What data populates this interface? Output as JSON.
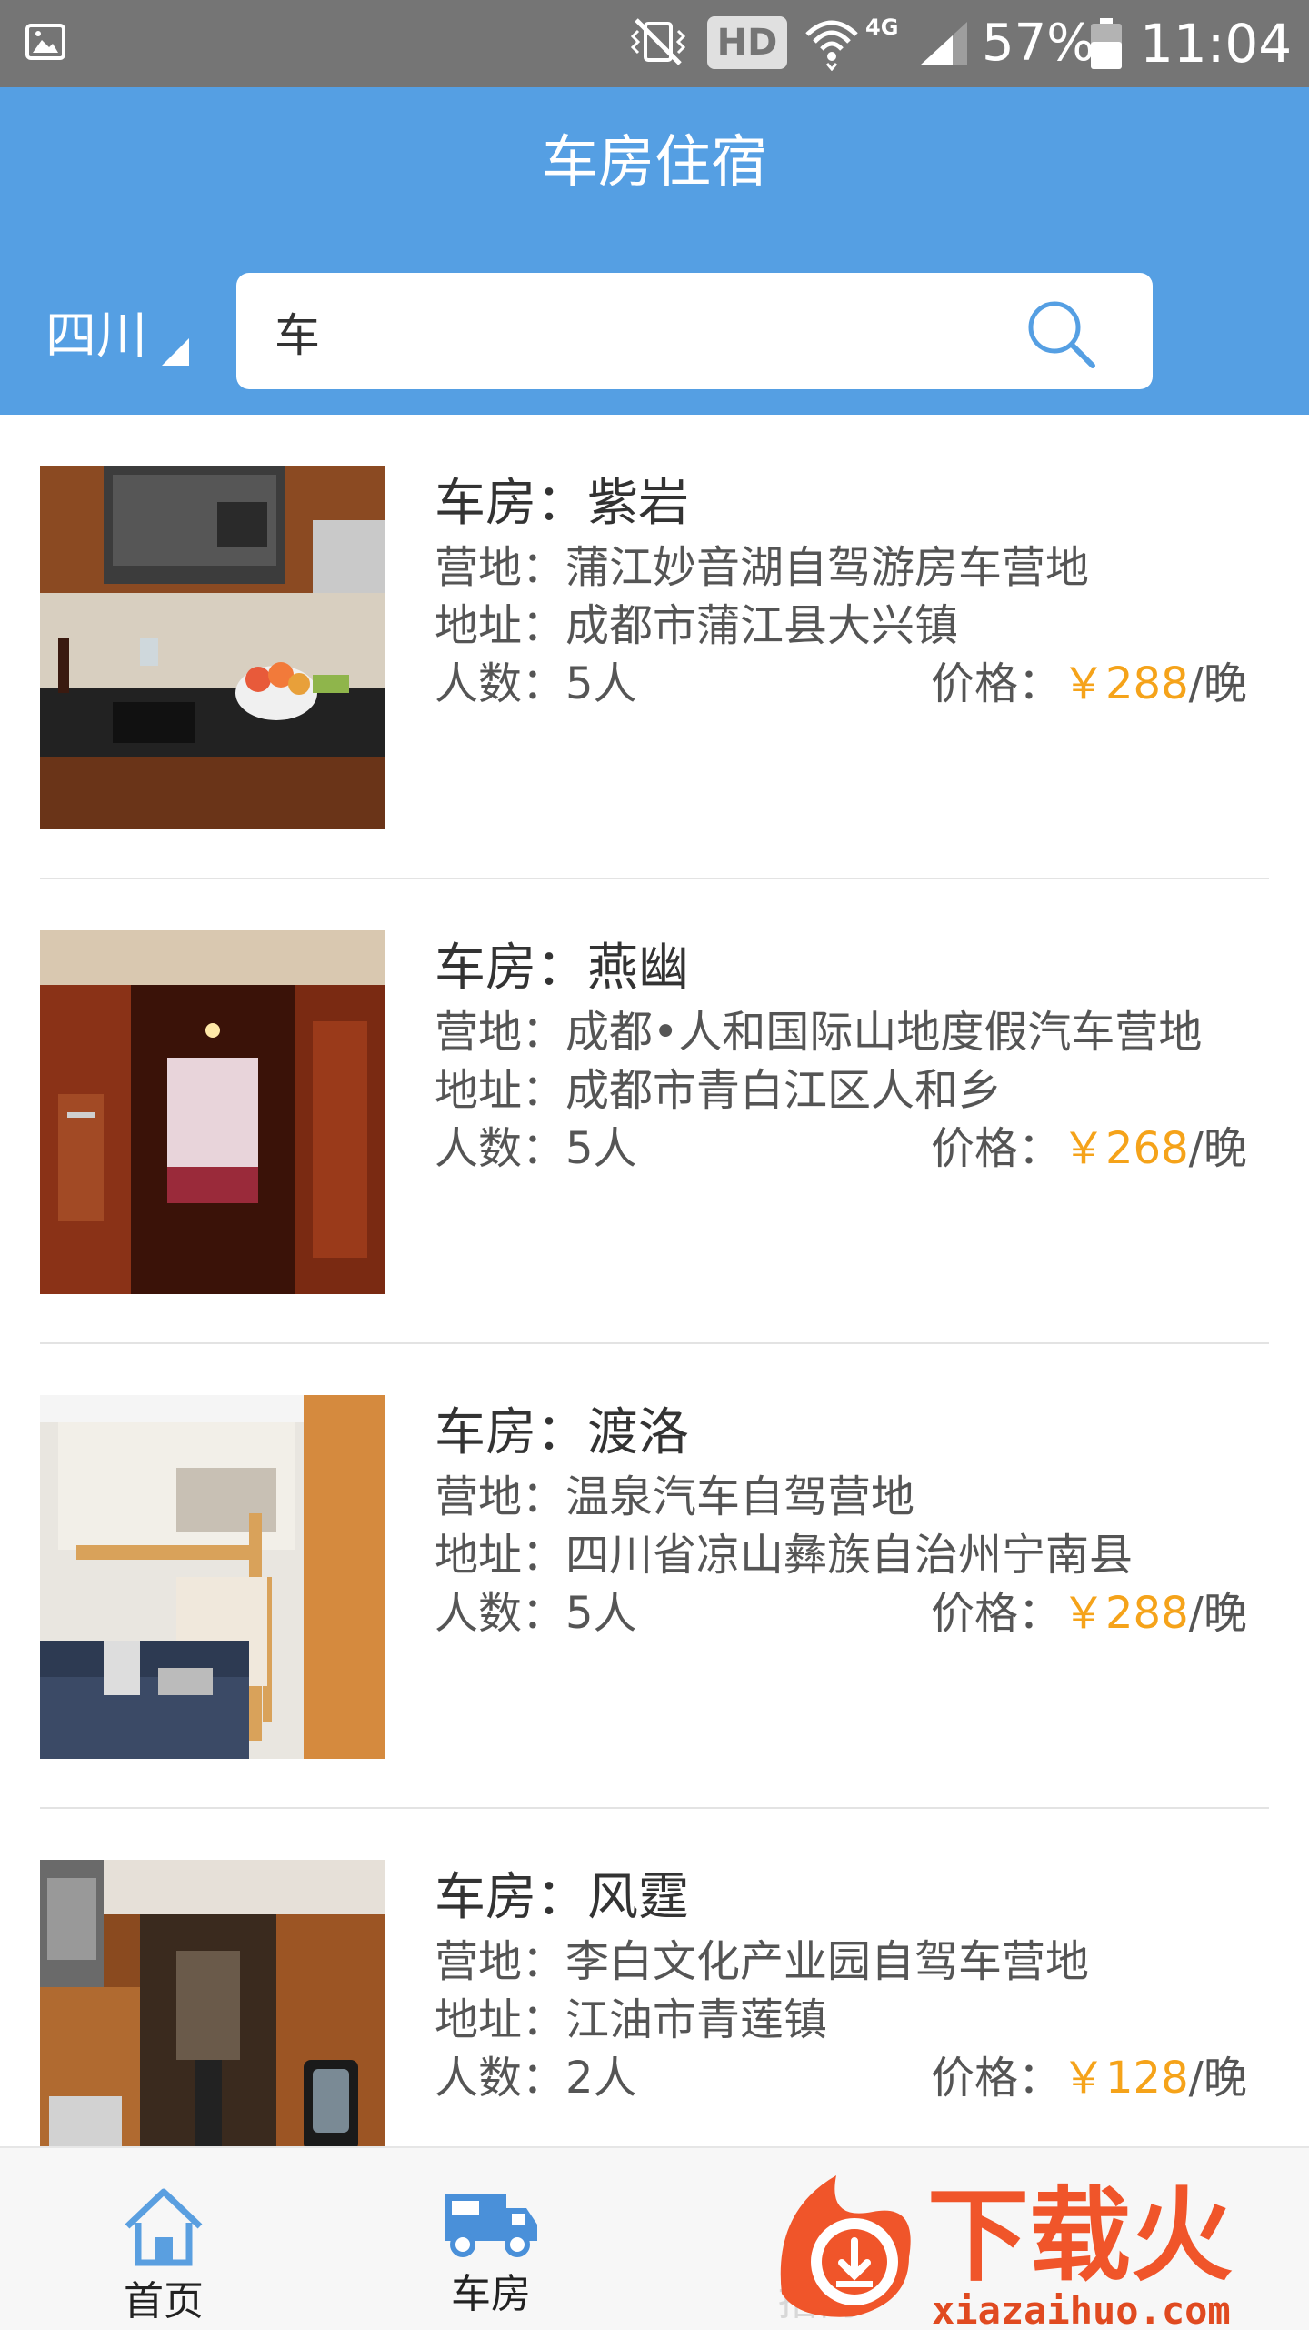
{
  "status_bar": {
    "network": "4G",
    "hd_label": "HD",
    "battery": "57%",
    "time": "11:04"
  },
  "header": {
    "title": "车房住宿",
    "region": "四川",
    "search": {
      "value": "车",
      "placeholder": ""
    },
    "accent": "#559fe3"
  },
  "listings": [
    {
      "name": "车房：紫岩",
      "camp": "营地：蒲江妙音湖自驾游房车营地",
      "address": "地址：成都市蒲江县大兴镇",
      "people": "人数：5人",
      "price_label": "价格：",
      "price": "￥288",
      "unit": "/晚"
    },
    {
      "name": "车房：燕幽",
      "camp": "营地：成都•人和国际山地度假汽车营地",
      "address": "地址：成都市青白江区人和乡",
      "people": "人数：5人",
      "price_label": "价格：",
      "price": "￥268",
      "unit": "/晚"
    },
    {
      "name": "车房：渡洛",
      "camp": "营地：温泉汽车自驾营地",
      "address": "地址：四川省凉山彝族自治州宁南县",
      "people": "人数：5人",
      "price_label": "价格：",
      "price": "￥288",
      "unit": "/晚"
    },
    {
      "name": "车房：风霆",
      "camp": "营地：李白文化产业园自驾车营地",
      "address": "地址：江油市青莲镇",
      "people": "人数：2人",
      "price_label": "价格：",
      "price": "￥128",
      "unit": "/晚"
    }
  ],
  "price_color": "#f5a31a",
  "bottom_nav": {
    "home": "首页",
    "rv": "车房",
    "biz": "招商"
  },
  "watermark": {
    "brand": "下载火",
    "url": "xiazaihuo.com"
  }
}
